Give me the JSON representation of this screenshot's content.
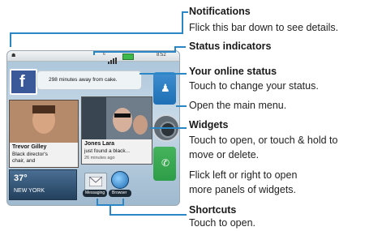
{
  "phone": {
    "status_time": "8:52",
    "status_signal": "6",
    "online_status_text": "298 minutes away from cake.",
    "contacts": [
      {
        "name": "Trevor Gilley",
        "line1": "Black director's",
        "line2": "chair, and"
      },
      {
        "name": "Jones Lara",
        "line1": "just found a black...",
        "line2": "26 minutes ago"
      }
    ],
    "weather": {
      "temp": "37°",
      "city": "NEW YORK"
    },
    "shortcuts": [
      {
        "label": "Messaging"
      },
      {
        "label": "Browser"
      }
    ],
    "social_logo": "f"
  },
  "annotations": {
    "notifications": {
      "title": "Notifications",
      "desc": "Flick this bar down to see details."
    },
    "status_indicators": {
      "title": "Status indicators"
    },
    "online_status": {
      "title": "Your online status",
      "desc": "Touch to change your status."
    },
    "main_menu": {
      "desc": "Open the main menu."
    },
    "widgets": {
      "title": "Widgets",
      "desc1": "Touch to open, or touch & hold to",
      "desc2": "move or delete."
    },
    "panels": {
      "desc1": "Flick left or right to open",
      "desc2": "more panels of widgets."
    },
    "shortcuts": {
      "title": "Shortcuts",
      "desc": "Touch to open."
    }
  },
  "colors": {
    "accent_line": "#2a86c4",
    "facebook_blue": "#3b5998",
    "phone_button_blue": "#1e6fb5",
    "phone_button_green": "#2e9d47"
  }
}
